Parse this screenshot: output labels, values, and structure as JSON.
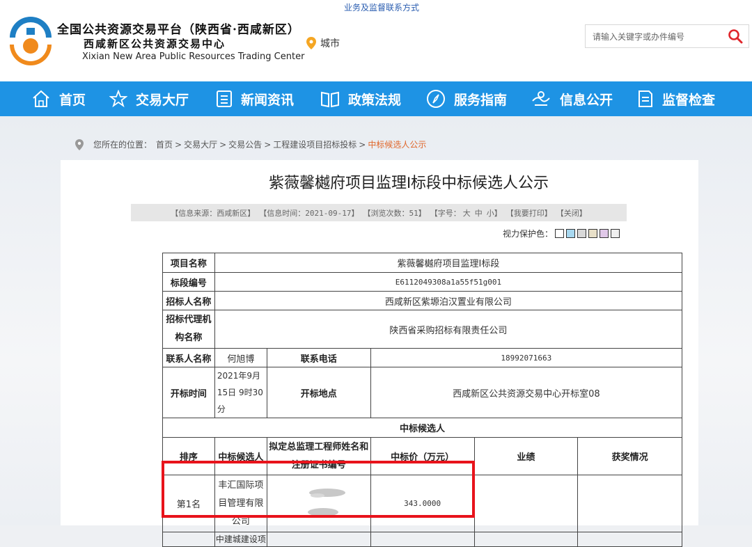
{
  "header": {
    "supervise_link": "业务及监督联系方式",
    "title": "全国公共资源交易平台（陕西省·西咸新区）",
    "subtitle": "西咸新区公共资源交易中心",
    "english_name": "Xixian New Area Public Resources Trading Center",
    "city_label": "城市",
    "search_placeholder": "请输入关键字或办件编号"
  },
  "nav": {
    "items": [
      {
        "label": "首页",
        "icon": "home-icon"
      },
      {
        "label": "交易大厅",
        "icon": "star-icon"
      },
      {
        "label": "新闻资讯",
        "icon": "news-icon"
      },
      {
        "label": "政策法规",
        "icon": "book-icon"
      },
      {
        "label": "服务指南",
        "icon": "compass-icon"
      },
      {
        "label": "信息公开",
        "icon": "handshake-icon"
      },
      {
        "label": "监督检查",
        "icon": "document-icon"
      }
    ]
  },
  "breadcrumb": {
    "prefix": "您所在的位置：",
    "items": [
      "首页",
      "交易大厅",
      "交易公告",
      "工程建设项目招标投标"
    ],
    "current": "中标候选人公示"
  },
  "article": {
    "title": "紫薇馨樾府项目监理I标段中标候选人公示",
    "info_source": "【信息来源：西咸新区】",
    "info_time": "【信息时间：2021-09-17】",
    "info_views": "【浏览次数：51】",
    "font_size_label": "【字号：",
    "font_large": "大",
    "font_medium": "中",
    "font_small": "小",
    "font_close": "】",
    "print_label": "【我要打印】",
    "close_label": "【关闭】",
    "eye_care_label": "视力保护色：",
    "swatches": [
      "#ffffff",
      "#a8d8f0",
      "#d8d8d8",
      "#e8e0c8",
      "#e0c8e8",
      "#f0f0f0"
    ]
  },
  "table": {
    "project_name_label": "项目名称",
    "project_name": "紫薇馨樾府项目监理I标段",
    "section_no_label": "标段编号",
    "section_no": "E6112049308a1a55f51g001",
    "tenderer_label": "招标人名称",
    "tenderer": "西咸新区紫塬泊汉置业有限公司",
    "agency_label": "招标代理机构名称",
    "agency": "陕西省采购招标有限责任公司",
    "contact_label": "联系人名称",
    "contact": "何旭博",
    "phone_label": "联系电话",
    "phone": "18992071663",
    "open_time_label": "开标时间",
    "open_time": "2021年9月15日 9时30分",
    "open_place_label": "开标地点",
    "open_place": "西咸新区公共资源交易中心开标室08",
    "candidates_header": "中标候选人",
    "columns": [
      "排序",
      "中标候选人",
      "拟定总监理工程师姓名和注册证书编号",
      "中标价（万元）",
      "业绩",
      "获奖情况"
    ],
    "rows": [
      {
        "rank": "第1名",
        "company": "丰汇国际项目管理有限公司",
        "engineer": "",
        "price": "343.0000",
        "performance": "",
        "awards": ""
      }
    ],
    "next_row_partial": "中建城建设项"
  }
}
